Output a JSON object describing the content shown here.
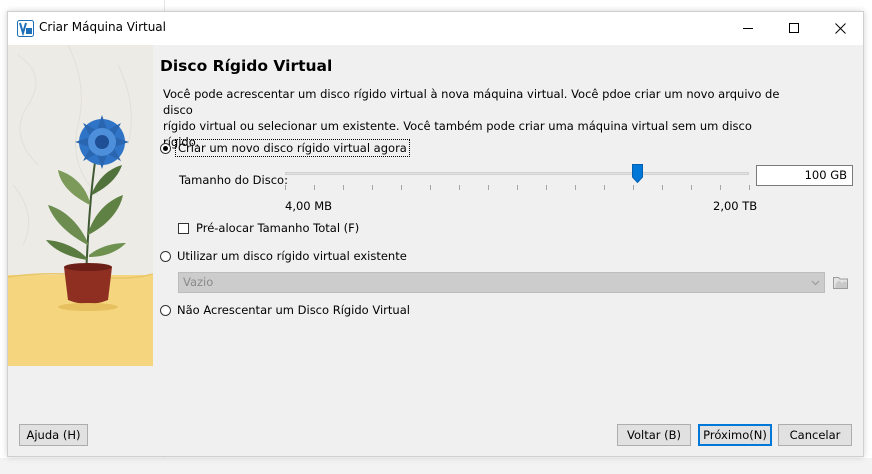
{
  "window": {
    "title": "Criar Máquina Virtual",
    "controls": [
      "minimize",
      "maximize",
      "close"
    ]
  },
  "page": {
    "heading": "Disco Rígido Virtual",
    "description_line1": "Você pode acrescentar um disco rígido virtual à nova máquina virtual. Você pdoe criar um novo arquivo de disco",
    "description_line2": "rígido virtual ou selecionar um existente. Você também pode criar uma máquina virtual sem um disco rígido."
  },
  "options": {
    "create_new": {
      "label": "Criar um novo disco rígido virtual agora",
      "selected": true
    },
    "use_existing": {
      "label": "Utilizar um disco rígido virtual existente",
      "selected": false
    },
    "no_disk": {
      "label": "Não Acrescentar um Disco Rígido Virtual",
      "selected": false
    }
  },
  "disk_size": {
    "label": "Tamanho do Disco:",
    "value": "100 GB",
    "range_min": "4,00 MB",
    "range_max": "2,00 TB",
    "slider_fraction": 0.76
  },
  "preallocate": {
    "label": "Pré-alocar Tamanho Total (F)",
    "checked": false
  },
  "existing_disk_select": {
    "value": "Vazio",
    "disabled": true
  },
  "buttons": {
    "help": "Ajuda (H)",
    "back": "Voltar (B)",
    "next": "Próximo(N)",
    "cancel": "Cancelar"
  },
  "colors": {
    "accent": "#0078d7",
    "dialog_bg": "#f0f0f0",
    "flower_blue": "#2f74c6",
    "pot": "#8e2f22",
    "sand": "#f5d57d"
  }
}
